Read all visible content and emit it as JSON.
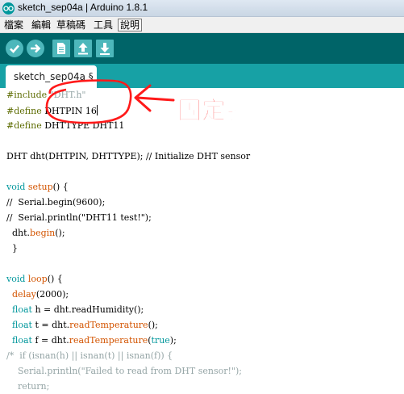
{
  "window": {
    "title": "sketch_sep04a | Arduino 1.8.1"
  },
  "menubar": {
    "items": [
      "檔案",
      "編輯",
      "草稿碼",
      "工具",
      "說明"
    ]
  },
  "toolbar": {
    "buttons": [
      "verify-icon",
      "upload-icon",
      "new-icon",
      "open-icon",
      "save-icon"
    ],
    "color_bg": "#006468",
    "color_button": "#4db7bb"
  },
  "tabs": [
    {
      "label": "sketch_sep04a §"
    }
  ],
  "annotation": {
    "label": "固定腳",
    "color": "#ff1a1a"
  },
  "editor": {
    "lines": [
      "#include \"DHT.h\"",
      "#define DHTPIN 16",
      "#define DHTTYPE DHT11",
      "",
      "DHT dht(DHTPIN, DHTTYPE); // Initialize DHT sensor",
      "",
      "void setup() {",
      "//  Serial.begin(9600);",
      "//  Serial.println(\"DHT11 test!\");",
      "  dht.begin();",
      "  }",
      "",
      "void loop() {",
      "  delay(2000);",
      "  float h = dht.readHumidity();",
      "  float t = dht.readTemperature();",
      "  float f = dht.readTemperature(true);",
      "/*  if (isnan(h) || isnan(t) || isnan(f)) {",
      "    Serial.println(\"Failed to read from DHT sensor!\");",
      "    return;"
    ]
  },
  "colors": {
    "preprocessor": "#5e6d03",
    "keyword": "#d35400",
    "type": "#00979c",
    "comment": "#95a5a6",
    "tabstrip": "#17a1a5"
  }
}
